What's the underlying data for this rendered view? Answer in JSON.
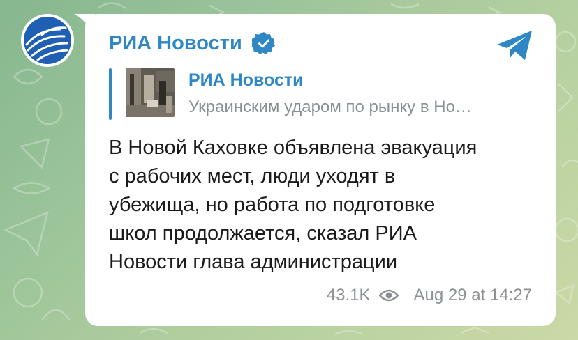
{
  "channel": {
    "name": "РИА Новости",
    "verified": true,
    "avatar_icon": "ria-globe-logo-icon",
    "accent_color": "#2f88c4"
  },
  "reply": {
    "title": "РИА Новости",
    "text": "Украинским ударом по рынку в Но…"
  },
  "message": {
    "lines": [
      "В Новой Каховке объявлена эвакуация",
      "с рабочих мест, люди уходят в",
      "убежища, но работа по подготовке",
      "школ продолжается, сказал РИА",
      "Новости глава администрации"
    ]
  },
  "meta": {
    "views": "43.1K",
    "timestamp": "Aug 29 at 14:27"
  },
  "icons": {
    "share": "telegram-share-icon",
    "views": "eye-icon",
    "verified": "verified-badge-icon"
  }
}
